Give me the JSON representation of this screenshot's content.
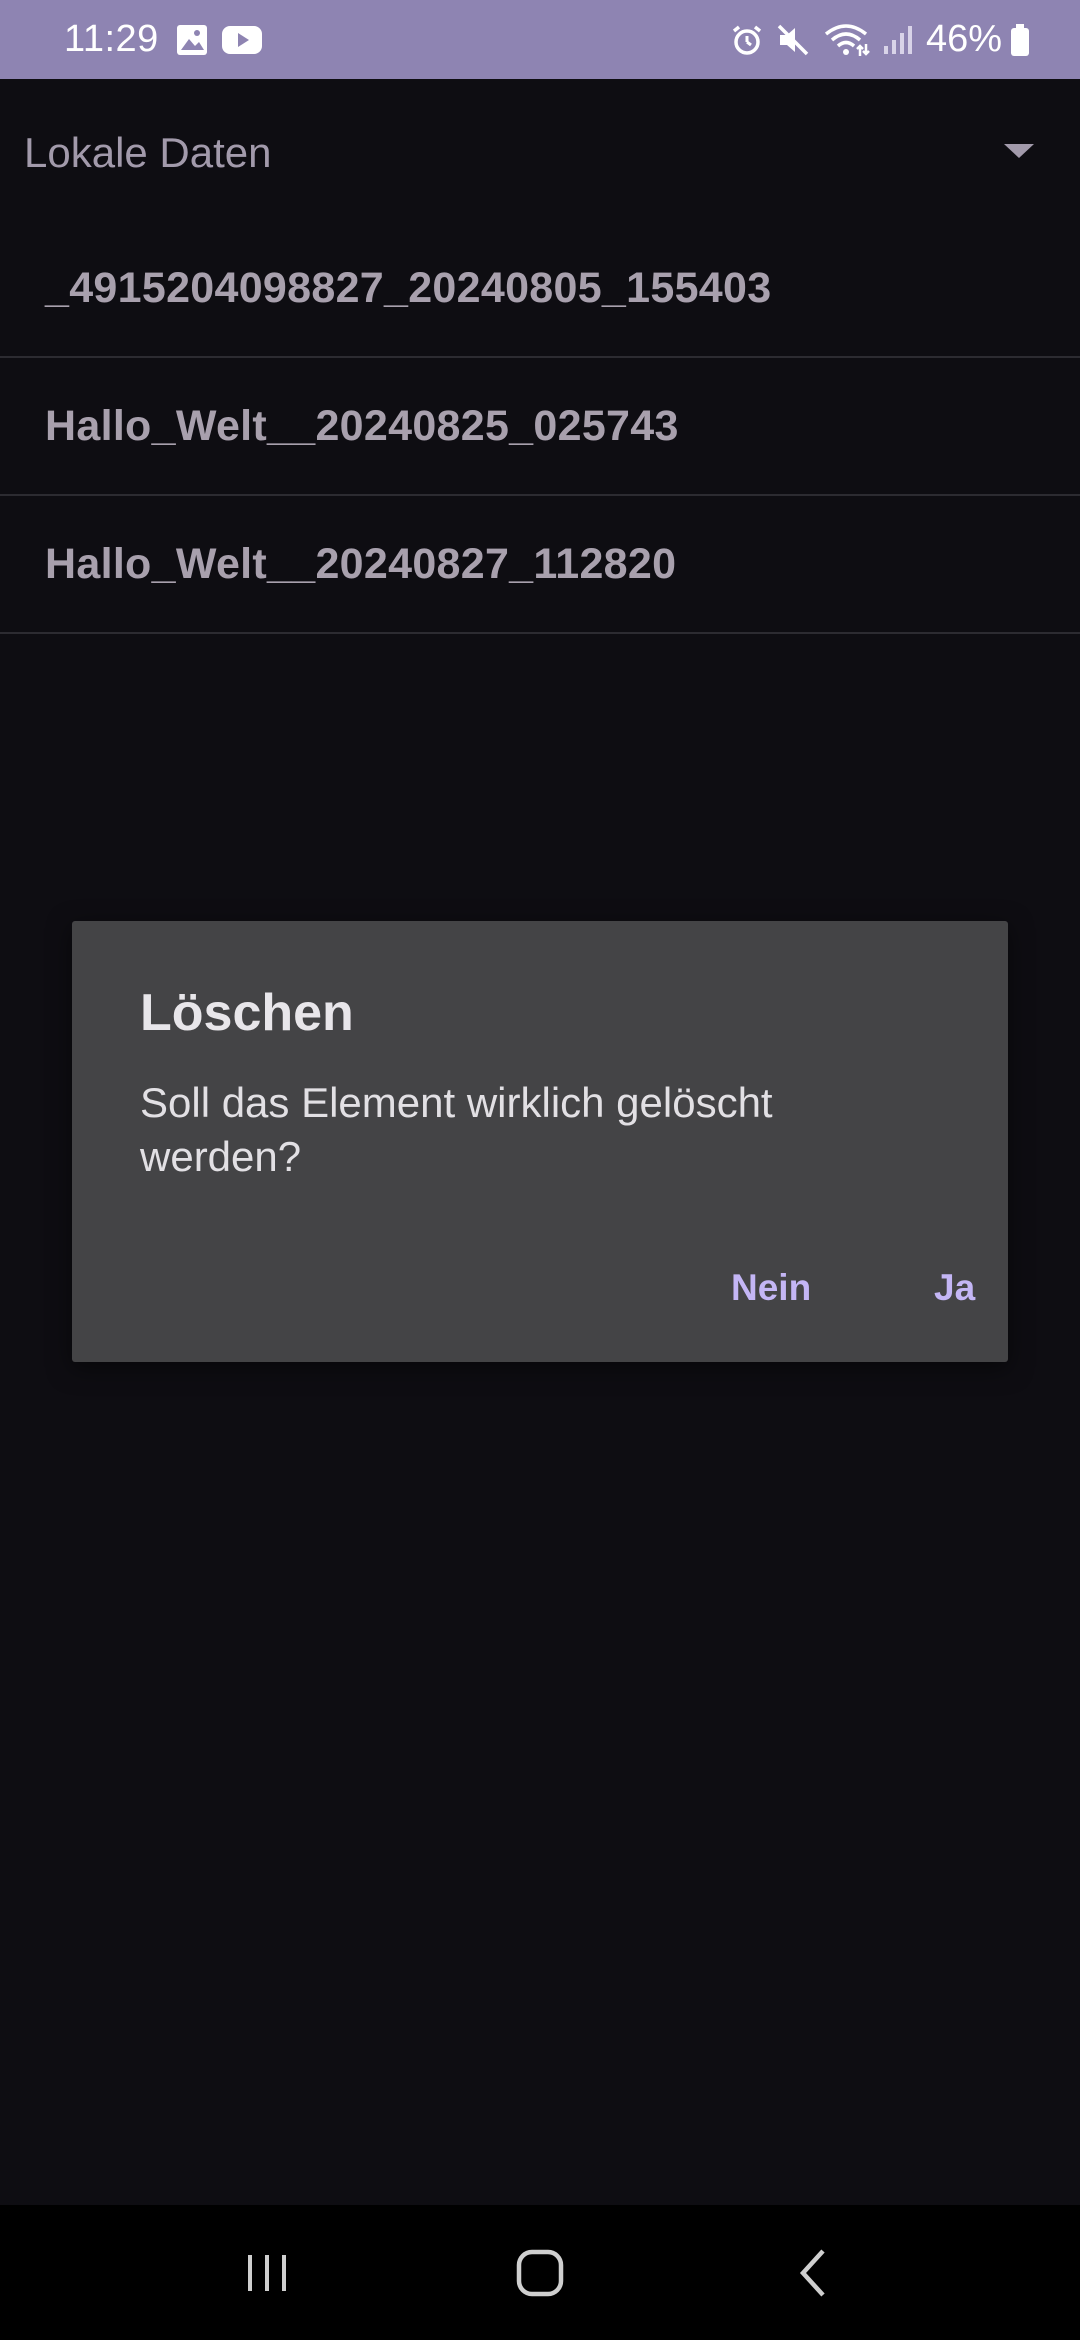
{
  "status_bar": {
    "time": "11:29",
    "battery_percent": "46%",
    "left_icons": [
      "gallery-icon",
      "youtube-icon"
    ],
    "right_icons": [
      "alarm-icon",
      "mute-icon",
      "wifi-icon",
      "signal-icon",
      "battery-icon"
    ],
    "background_color": "#8e84b2"
  },
  "spinner": {
    "selected": "Lokale Daten"
  },
  "list": {
    "items": [
      {
        "label": "_4915204098827_20240805_155403"
      },
      {
        "label": "Hallo_Welt__20240825_025743"
      },
      {
        "label": "Hallo_Welt__20240827_112820"
      }
    ]
  },
  "dialog": {
    "title": "Löschen",
    "message": "Soll das Element wirklich gelöscht werden?",
    "negative_label": "Nein",
    "positive_label": "Ja",
    "accent_color": "#c4b6f5"
  },
  "colors": {
    "background": "#0e0d12",
    "dialog_background": "#444446"
  }
}
